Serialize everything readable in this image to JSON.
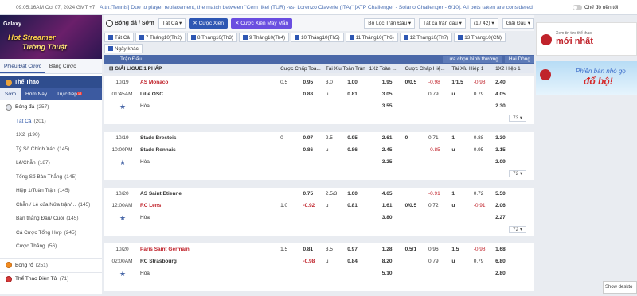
{
  "topbar": {
    "clock": "09:05:16AM Oct 07, 2024 GMT +7",
    "notice": "Attn:[Tennis] Due to player replacement, the match between \"Cem Ilkel (TUR) -vs- Lorenzo Claverie (ITA)\" [ATP Challenger - Solano Challenger - 6/10]. All bets taken are considered",
    "night_label": "Chế độ nền tối"
  },
  "left": {
    "banner_brand": "Galaxy",
    "banner_line1": "Hot Streamer",
    "banner_line2": "Tường Thuật",
    "tab_slip": "Phiếu Đặt Cược",
    "tab_table": "Bảng Cược",
    "sport_header": "Thể Thao",
    "subtabs": [
      "Sớm",
      "Hôm Nay",
      "Trực tiếp"
    ],
    "live_badge": "12",
    "menu_head": "Bóng đá",
    "menu_head_count": "(257)",
    "menu": [
      {
        "label": "Tất Cả",
        "count": "(201)"
      },
      {
        "label": "1X2",
        "count": "(190)"
      },
      {
        "label": "Tỷ Số Chính Xác",
        "count": "(145)"
      },
      {
        "label": "Lẻ/Chẵn",
        "count": "(187)"
      },
      {
        "label": "Tổng Số Bàn Thắng",
        "count": "(145)"
      },
      {
        "label": "Hiệp 1/Toàn Trận",
        "count": "(145)"
      },
      {
        "label": "Chẵn / Lẻ của Nửa trận/...",
        "count": "(145)"
      },
      {
        "label": "Bàn thắng Đầu/ Cuối",
        "count": "(145)"
      },
      {
        "label": "Cá Cược Tổng Hợp",
        "count": "(245)"
      },
      {
        "label": "Cược Thắng",
        "count": "(56)"
      }
    ],
    "bottom": [
      {
        "label": "Bóng rổ",
        "count": "(251)"
      },
      {
        "label": "Thể Thao Điện Tử",
        "count": "(71)"
      }
    ]
  },
  "filter": {
    "title": "Bóng đá / Sớm",
    "all": "Tất Cả",
    "parlay": "Cược Xiên",
    "parlay_lucky": "Cược Xiên May Mắn",
    "league_filter": "Bộ Lọc Trận Đấu",
    "all_leagues": "Tất cả trận đấu",
    "pager": "(1 / 42)",
    "display": "Giải Đấu"
  },
  "dates": [
    "Tất Cả",
    "7 Tháng10(Th2)",
    "8 Tháng10(Th3)",
    "9 Tháng10(Th4)",
    "10 Tháng10(Th5)",
    "11 Tháng10(Th6)",
    "12 Tháng10(Th7)",
    "13 Tháng10(CN)",
    "Ngày khác"
  ],
  "table": {
    "match_header": "Trận Đấu",
    "sort": "Lựa chọn bình thường",
    "view": "Hai Dòng",
    "league": "GIẢI LIGUE 1 PHÁP",
    "cols": [
      "Cược Chấp Toà...",
      "Tài Xỉu Toàn Trận",
      "1X2 Toàn ...",
      "Cược Chấp Hiệ...",
      "Tài Xỉu Hiệp 1",
      "1X2 Hiệp 1"
    ]
  },
  "matches": [
    {
      "date": "10/19",
      "time": "01:45AM",
      "home": "AS Monaco",
      "away": "Lille OSC",
      "draw": "Hòa",
      "home_red": true,
      "away_red": false,
      "more": "73",
      "r1": [
        "0.5",
        "0.95",
        "3.0",
        "1.00",
        "1.95",
        "0/0.5",
        "-0.98",
        "1/1.5",
        "-0.98",
        "2.40"
      ],
      "r2": [
        "",
        "0.88",
        "u",
        "0.81",
        "3.05",
        "",
        "0.79",
        "u",
        "0.79",
        "4.05"
      ],
      "r3": "3.55",
      "r3b": "2.30"
    },
    {
      "date": "10/19",
      "time": "10:00PM",
      "home": "Stade Brestois",
      "away": "Stade Rennais",
      "draw": "Hòa",
      "home_red": false,
      "away_red": false,
      "more": "72",
      "r1": [
        "0",
        "0.97",
        "2.5",
        "0.95",
        "2.61",
        "0",
        "0.71",
        "1",
        "0.88",
        "3.30"
      ],
      "r2": [
        "",
        "0.86",
        "u",
        "0.86",
        "2.45",
        "",
        "-0.85",
        "u",
        "0.95",
        "3.15"
      ],
      "r3": "3.25",
      "r3b": "2.09"
    },
    {
      "date": "10/20",
      "time": "12:00AM",
      "home": "AS Saint Etienne",
      "away": "RC Lens",
      "draw": "Hòa",
      "home_red": false,
      "away_red": true,
      "more": "72",
      "r1": [
        "",
        "0.75",
        "2.5/3",
        "1.00",
        "4.65",
        "",
        "-0.91",
        "1",
        "0.72",
        "5.50"
      ],
      "r2": [
        "1.0",
        "-0.92",
        "u",
        "0.81",
        "1.61",
        "0/0.5",
        "0.72",
        "u",
        "-0.91",
        "2.06"
      ],
      "r3": "3.80",
      "r3b": "2.27"
    },
    {
      "date": "10/20",
      "time": "02:00AM",
      "home": "Paris Saint Germain",
      "away": "RC Strasbourg",
      "draw": "Hòa",
      "home_red": true,
      "away_red": false,
      "more": "",
      "r1": [
        "1.5",
        "0.81",
        "3.5",
        "0.97",
        "1.28",
        "0.5/1",
        "0.96",
        "1.5",
        "-0.98",
        "1.68"
      ],
      "r2": [
        "",
        "-0.98",
        "u",
        "0.84",
        "8.20",
        "",
        "0.79",
        "u",
        "0.79",
        "6.80"
      ],
      "r3": "5.10",
      "r3b": "2.80"
    }
  ],
  "ads": {
    "ad1_small": "Xem tin tức thể thao",
    "ad1_big": "mới nhất",
    "ad2_line1": "Phiên bản nhỏ gọ",
    "ad2_line2": "đổ bộ!"
  },
  "show_desktop": "Show deskto"
}
